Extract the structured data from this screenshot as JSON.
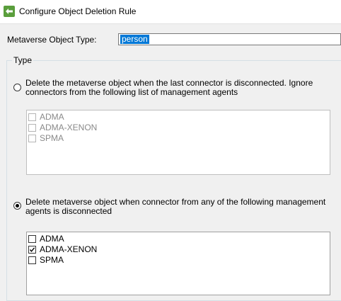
{
  "window": {
    "title": "Configure Object Deletion Rule",
    "icon": "sync-rule-icon"
  },
  "form": {
    "mv_type_label": "Metaverse Object Type:",
    "mv_type_value": "person"
  },
  "type_group": {
    "legend": "Type",
    "option1": {
      "selected": false,
      "text": "Delete the metaverse object when the last connector is disconnected. Ignore connectors from the following list of management agents",
      "list_enabled": false,
      "items": [
        {
          "label": "ADMA",
          "checked": false
        },
        {
          "label": "ADMA-XENON",
          "checked": false
        },
        {
          "label": "SPMA",
          "checked": false
        }
      ]
    },
    "option2": {
      "selected": true,
      "text": "Delete metaverse object when connector from any of the following management agents is disconnected",
      "list_enabled": true,
      "items": [
        {
          "label": "ADMA",
          "checked": false
        },
        {
          "label": "ADMA-XENON",
          "checked": true
        },
        {
          "label": "SPMA",
          "checked": false
        }
      ]
    }
  }
}
